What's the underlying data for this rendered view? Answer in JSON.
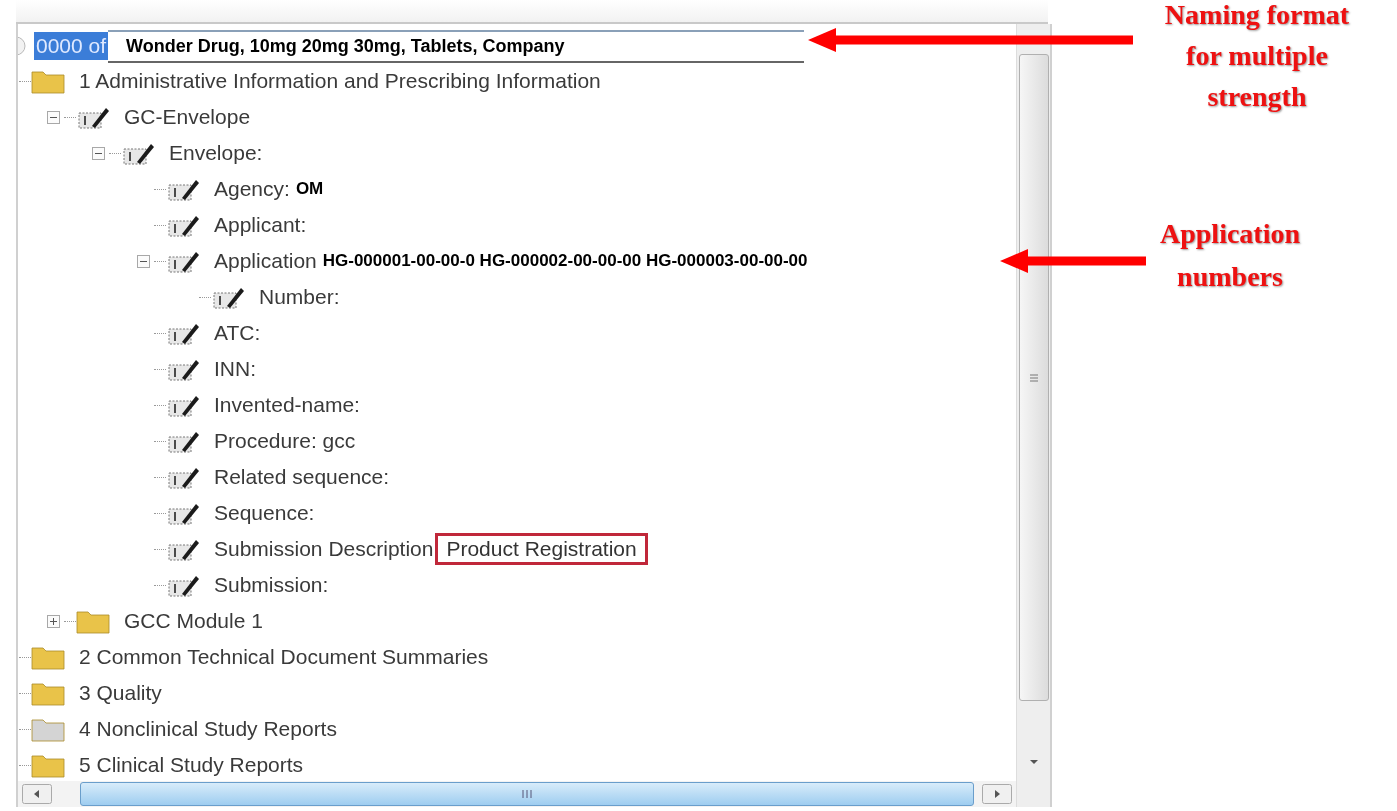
{
  "header": {
    "selected_text": "0000 of",
    "name_overlay": "Wonder Drug, 10mg 20mg 30mg, Tablets, Company"
  },
  "tree": [
    {
      "kind": "folder",
      "color": "#e9c349",
      "label": "1 Administrative Information and Prescribing Information",
      "children": [
        {
          "kind": "element",
          "label": "GC-Envelope",
          "expanded": true,
          "children": [
            {
              "kind": "element",
              "label": "Envelope:",
              "expanded": true,
              "children": [
                {
                  "kind": "element",
                  "label": "Agency:",
                  "value": "OM",
                  "boxed": false
                },
                {
                  "kind": "element",
                  "label": "Applicant:"
                },
                {
                  "kind": "element",
                  "label": "Application",
                  "value": "HG-000001-00-00-0 HG-000002-00-00-00 HG-000003-00-00-00",
                  "boxed": false,
                  "expanded": true,
                  "children": [
                    {
                      "kind": "element",
                      "label": "Number:"
                    }
                  ]
                },
                {
                  "kind": "element",
                  "label": "ATC:"
                },
                {
                  "kind": "element",
                  "label": "INN:"
                },
                {
                  "kind": "element",
                  "label": "Invented-name:"
                },
                {
                  "kind": "element",
                  "label": "Procedure: gcc"
                },
                {
                  "kind": "element",
                  "label": "Related sequence:"
                },
                {
                  "kind": "element",
                  "label": "Sequence:"
                },
                {
                  "kind": "element",
                  "label": "Submission Description",
                  "value": "Product Registration",
                  "boxed": true
                },
                {
                  "kind": "element",
                  "label": "Submission:"
                }
              ]
            }
          ]
        },
        {
          "kind": "folder",
          "color": "#e9c349",
          "label": "GCC Module 1",
          "expanded": false
        }
      ]
    },
    {
      "kind": "folder",
      "color": "#e9c349",
      "label": "2 Common Technical Document Summaries"
    },
    {
      "kind": "folder",
      "color": "#e9c349",
      "label": "3 Quality"
    },
    {
      "kind": "folder",
      "color": "#d4d4d4",
      "label": "4 Nonclinical Study Reports"
    },
    {
      "kind": "folder",
      "color": "#e9c349",
      "label": "5 Clinical Study Reports"
    }
  ],
  "annotations": [
    {
      "lines": [
        "Naming format",
        "for multiple",
        "strength"
      ]
    },
    {
      "lines": [
        "Application",
        "numbers"
      ]
    }
  ]
}
